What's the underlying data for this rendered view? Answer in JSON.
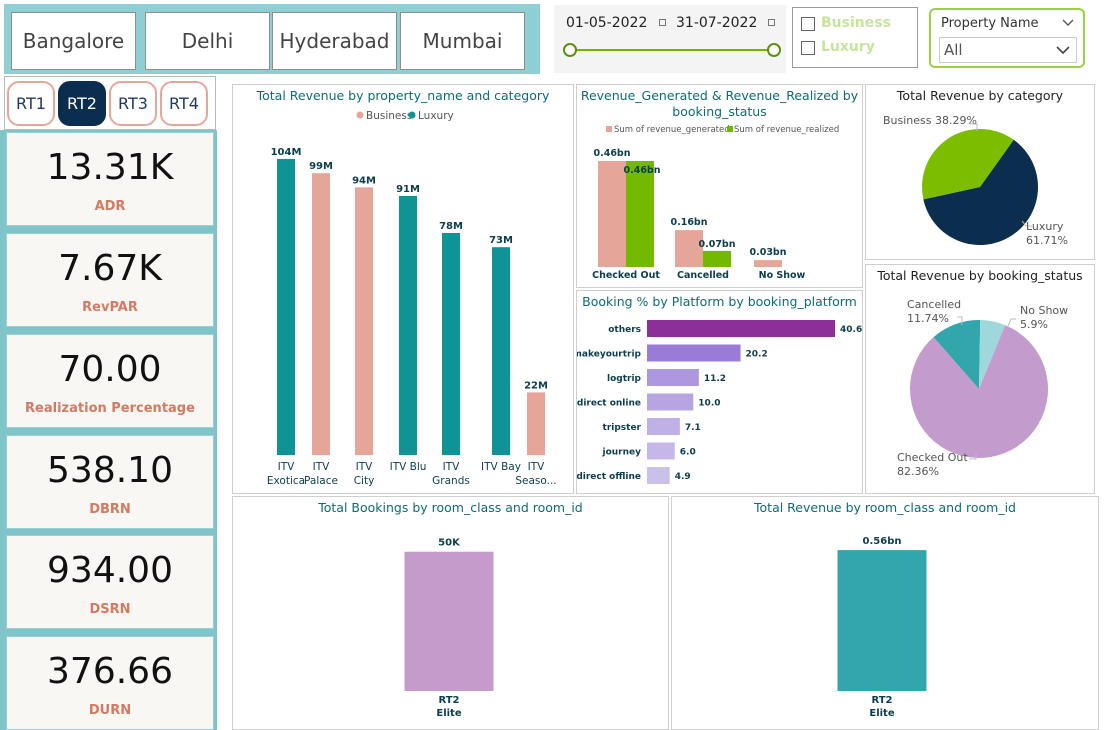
{
  "city_slicer": {
    "cities": [
      "Bangalore",
      "Delhi",
      "Hyderabad",
      "Mumbai"
    ]
  },
  "date_slicer": {
    "start": "01-05-2022",
    "end": "31-07-2022"
  },
  "category_filter": {
    "options": [
      "Business",
      "Luxury"
    ]
  },
  "property_filter": {
    "title": "Property Name",
    "selected": "All"
  },
  "room_types": {
    "buttons": [
      "RT1",
      "RT2",
      "RT3",
      "RT4"
    ],
    "active": "RT2"
  },
  "kpis": [
    {
      "value": "13.31K",
      "label": "ADR"
    },
    {
      "value": "7.67K",
      "label": "RevPAR"
    },
    {
      "value": "70.00",
      "label": "Realization Percentage"
    },
    {
      "value": "538.10",
      "label": "DBRN"
    },
    {
      "value": "934.00",
      "label": "DSRN"
    },
    {
      "value": "376.66",
      "label": "DURN"
    }
  ],
  "colors": {
    "business": "#e5a699",
    "luxury": "#0e9494",
    "generated": "#e5a699",
    "realized": "#72b900",
    "platform": "#8d2f98",
    "room_bookings": "#c49bcb",
    "room_revenue": "#33a6ab",
    "navy": "#0c2e4e",
    "green": "#7dbd00"
  },
  "chart_data": [
    {
      "type": "bar",
      "title": "Total Revenue by property_name and category",
      "categories": [
        "ITV Exotica",
        "ITV Palace",
        "ITV City",
        "ITV Blu",
        "ITV Grands",
        "ITV Bay",
        "ITV Seaso..."
      ],
      "category_lines": [
        [
          "ITV",
          "Exotica"
        ],
        [
          "ITV",
          "Palace"
        ],
        [
          "ITV",
          "City"
        ],
        [
          "ITV Blu",
          ""
        ],
        [
          "ITV",
          "Grands"
        ],
        [
          "ITV Bay",
          ""
        ],
        [
          "ITV",
          "Seaso..."
        ]
      ],
      "series": [
        {
          "name": "Business",
          "values": [
            null,
            99,
            94,
            null,
            null,
            null,
            22
          ]
        },
        {
          "name": "Luxury",
          "values": [
            104,
            null,
            null,
            91,
            78,
            73,
            null
          ]
        }
      ],
      "labels": [
        "104M",
        "99M",
        "94M",
        "91M",
        "78M",
        "73M",
        "22M"
      ],
      "unit": "M",
      "ylim": [
        0,
        110
      ]
    },
    {
      "type": "bar",
      "title": "Revenue_Generated & Revenue_Realized by booking_status",
      "title_lines": [
        "Revenue_Generated & Revenue_Realized by",
        "booking_status"
      ],
      "categories": [
        "Checked Out",
        "Cancelled",
        "No Show"
      ],
      "series": [
        {
          "name": "Sum of revenue_generated",
          "values": [
            0.46,
            0.16,
            0.03
          ],
          "labels": [
            "0.46bn",
            "0.16bn",
            "0.03bn"
          ]
        },
        {
          "name": "Sum of revenue_realized",
          "values": [
            0.46,
            0.07,
            0.0
          ],
          "labels": [
            "0.46bn",
            "0.07bn",
            ""
          ]
        }
      ],
      "ylim": [
        0,
        0.5
      ]
    },
    {
      "type": "pie",
      "title": "Total Revenue by category",
      "slices": [
        {
          "name": "Business",
          "percent": 38.29,
          "label": "Business 38.29%"
        },
        {
          "name": "Luxury",
          "percent": 61.71,
          "label_lines": [
            "Luxury",
            "61.71%"
          ]
        }
      ]
    },
    {
      "type": "bar",
      "orientation": "horizontal",
      "title": "Booking % by Platform by booking_platform",
      "categories": [
        "others",
        "makeyourtrip",
        "logtrip",
        "direct online",
        "tripster",
        "journey",
        "direct offline"
      ],
      "values": [
        40.6,
        20.2,
        11.2,
        10.0,
        7.1,
        6.0,
        4.9
      ],
      "labels": [
        "40.6",
        "20.2",
        "11.2",
        "10.0",
        "7.1",
        "6.0",
        "4.9"
      ]
    },
    {
      "type": "pie",
      "title": "Total Revenue by booking_status",
      "slices": [
        {
          "name": "Checked Out",
          "percent": 82.36,
          "label_lines": [
            "Checked Out",
            "82.36%"
          ]
        },
        {
          "name": "Cancelled",
          "percent": 11.74,
          "label_lines": [
            "Cancelled",
            "11.74%"
          ]
        },
        {
          "name": "No Show",
          "percent": 5.9,
          "label_lines": [
            "No Show",
            "5.9%"
          ]
        }
      ]
    },
    {
      "type": "bar",
      "title": "Total Bookings by room_class and room_id",
      "categories": [
        "RT2 Elite"
      ],
      "category_lines": [
        [
          "RT2",
          "Elite"
        ]
      ],
      "values": [
        50
      ],
      "labels": [
        "50K"
      ],
      "ylim": [
        0,
        56
      ]
    },
    {
      "type": "bar",
      "title": "Total Revenue by room_class and room_id",
      "categories": [
        "RT2 Elite"
      ],
      "category_lines": [
        [
          "RT2",
          "Elite"
        ]
      ],
      "values": [
        0.56
      ],
      "labels": [
        "0.56bn"
      ],
      "ylim": [
        0,
        0.62
      ]
    }
  ]
}
